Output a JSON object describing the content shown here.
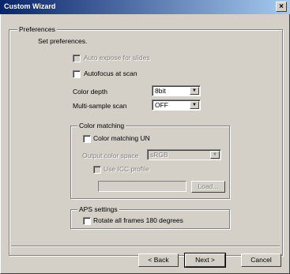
{
  "window": {
    "title": "Custom Wizard",
    "close_glyph": "×"
  },
  "preferences": {
    "legend": "Preferences",
    "intro": "Set preferences.",
    "auto_expose": "Auto expose for slides",
    "autofocus": "Autofocus at scan",
    "color_depth_label": "Color depth",
    "color_depth_value": "8bit",
    "multisample_label": "Multi-sample scan",
    "multisample_value": "OFF"
  },
  "color_matching": {
    "legend": "Color matching",
    "enable": "Color matching UN",
    "output_space_label": "Output color space",
    "output_space_value": "sRGB",
    "use_icc": "Use ICC profile",
    "icc_path": "",
    "load_button": "Load..."
  },
  "aps": {
    "legend": "APS settings",
    "rotate": "Rotate all frames 180 degrees"
  },
  "buttons": {
    "back": "< Back",
    "next": "Next >",
    "cancel": "Cancel"
  },
  "icons": {
    "dropdown": "▼"
  }
}
